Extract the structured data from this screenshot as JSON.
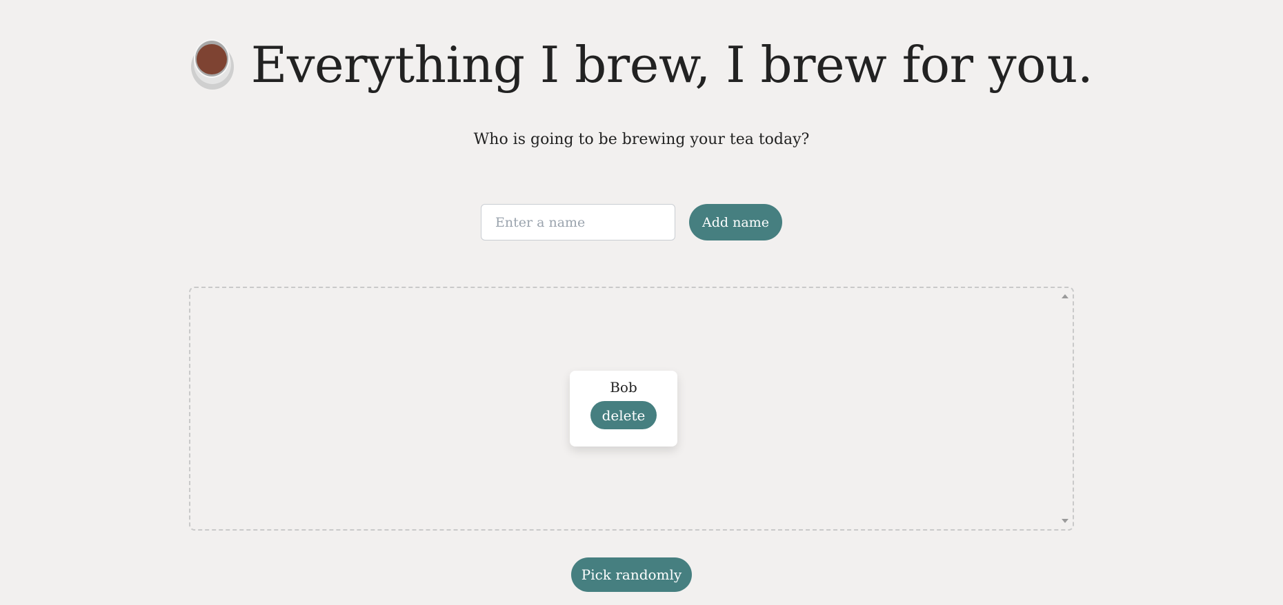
{
  "header": {
    "title": "Everything I brew, I brew for you.",
    "icon": "tea-cup-icon"
  },
  "subtitle": "Who is going to be brewing your tea today?",
  "form": {
    "input_placeholder": "Enter a name",
    "input_value": "",
    "add_label": "Add name"
  },
  "names": [
    {
      "name": "Bob",
      "delete_label": "delete"
    }
  ],
  "pick_label": "Pick randomly",
  "colors": {
    "background": "#f2f0ef",
    "accent": "#467f80",
    "tea": "#7e4332"
  }
}
